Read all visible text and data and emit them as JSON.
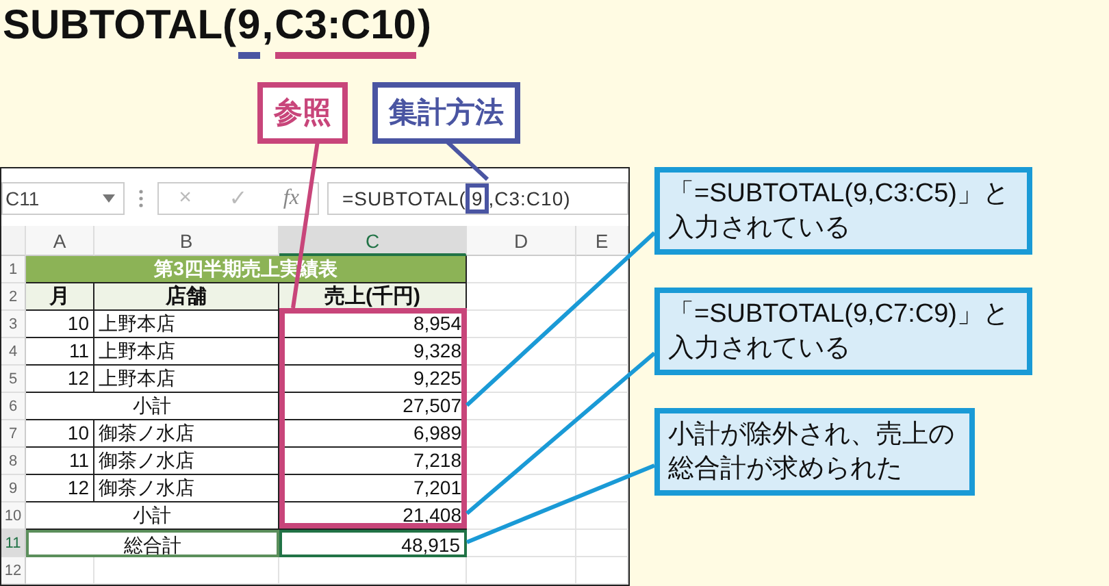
{
  "title": {
    "parts": [
      {
        "text": "SUBTOTAL(",
        "kind": "plain"
      },
      {
        "text": "9",
        "kind": "method"
      },
      {
        "text": ",",
        "kind": "plain"
      },
      {
        "text": "C3:C10",
        "kind": "reference"
      },
      {
        "text": ")",
        "kind": "plain"
      }
    ]
  },
  "labels": [
    {
      "text": "参照",
      "kind": "reference"
    },
    {
      "text": "集計方法",
      "kind": "method"
    }
  ],
  "sheet": {
    "name_box": "C11",
    "cancel": "×",
    "enter": "✓",
    "function": "fx",
    "formula": [
      {
        "text": "=SUBTOTAL(",
        "kind": "plain"
      },
      {
        "text": "9",
        "kind": "method"
      },
      {
        "text": ",C3:C10)",
        "kind": "plain"
      }
    ],
    "columns": [
      {
        "label": "A",
        "selected": false
      },
      {
        "label": "B",
        "selected": false
      },
      {
        "label": "C",
        "selected": true
      },
      {
        "label": "D",
        "selected": false
      },
      {
        "label": "E",
        "selected": false
      }
    ],
    "rows": [
      {
        "number": "1",
        "selected": false,
        "kind": "title",
        "cells": [
          "第3四半期売上実績表"
        ]
      },
      {
        "number": "2",
        "selected": false,
        "kind": "header",
        "cells": [
          "月",
          "店舗",
          "売上(千円)"
        ]
      },
      {
        "number": "3",
        "selected": false,
        "kind": "data",
        "cells": [
          "10",
          "上野本店",
          "8,954"
        ]
      },
      {
        "number": "4",
        "selected": false,
        "kind": "data",
        "cells": [
          "11",
          "上野本店",
          "9,328"
        ]
      },
      {
        "number": "5",
        "selected": false,
        "kind": "data",
        "cells": [
          "12",
          "上野本店",
          "9,225"
        ]
      },
      {
        "number": "6",
        "selected": false,
        "kind": "subtotal",
        "cells": [
          "小計",
          "27,507"
        ]
      },
      {
        "number": "7",
        "selected": false,
        "kind": "data",
        "cells": [
          "10",
          "御茶ノ水店",
          "6,989"
        ]
      },
      {
        "number": "8",
        "selected": false,
        "kind": "data",
        "cells": [
          "11",
          "御茶ノ水店",
          "7,218"
        ]
      },
      {
        "number": "9",
        "selected": false,
        "kind": "data",
        "cells": [
          "12",
          "御茶ノ水店",
          "7,201"
        ]
      },
      {
        "number": "10",
        "selected": false,
        "kind": "subtotal",
        "cells": [
          "小計",
          "21,408"
        ]
      },
      {
        "number": "11",
        "selected": true,
        "kind": "total",
        "cells": [
          "総合計",
          "48,915"
        ]
      },
      {
        "number": "12",
        "selected": false,
        "kind": "empty",
        "cells": []
      }
    ]
  },
  "callouts": [
    {
      "text": "「=SUBTOTAL(9,C3:C5)」と入力されている"
    },
    {
      "text": "「=SUBTOTAL(9,C7:C9)」と入力されている"
    },
    {
      "text": "小計が除外され、売上の総合計が求められた"
    }
  ]
}
